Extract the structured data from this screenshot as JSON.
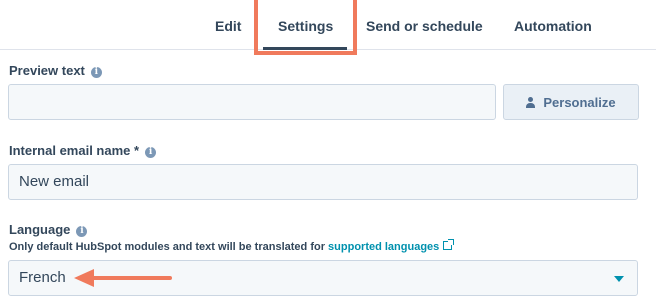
{
  "tabs": [
    {
      "label": "Edit"
    },
    {
      "label": "Settings",
      "active": true
    },
    {
      "label": "Send or schedule"
    },
    {
      "label": "Automation"
    }
  ],
  "preview": {
    "label": "Preview text",
    "value": "",
    "personalize_label": "Personalize"
  },
  "internal_name": {
    "label": "Internal email name *",
    "value": "New email"
  },
  "language": {
    "label": "Language",
    "help_prefix": "Only default HubSpot modules and text will be translated for ",
    "help_link": "supported languages",
    "selected": "French"
  },
  "colors": {
    "annotation": "#f07a5c",
    "link": "#0091ae",
    "text": "#33475b"
  },
  "icons": [
    "info-icon",
    "person-icon",
    "external-link-icon",
    "caret-down-icon",
    "annotation-arrow"
  ]
}
